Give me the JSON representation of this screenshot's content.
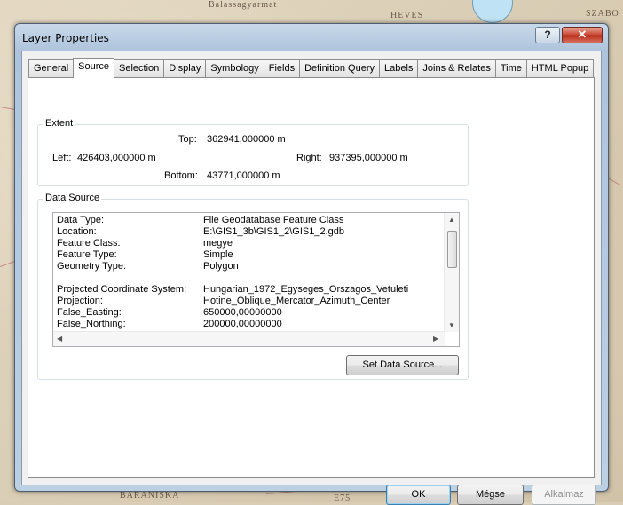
{
  "background_map": {
    "labels": [
      "Balassagyarmat",
      "HEVES",
      "SZABO",
      "BARANISKA",
      "E75"
    ]
  },
  "window": {
    "title": "Layer Properties",
    "help_label": "?",
    "close_label": "✕"
  },
  "tabs": [
    {
      "label": "General"
    },
    {
      "label": "Source",
      "active": true
    },
    {
      "label": "Selection"
    },
    {
      "label": "Display"
    },
    {
      "label": "Symbology"
    },
    {
      "label": "Fields"
    },
    {
      "label": "Definition Query"
    },
    {
      "label": "Labels"
    },
    {
      "label": "Joins & Relates"
    },
    {
      "label": "Time"
    },
    {
      "label": "HTML Popup"
    }
  ],
  "extent": {
    "label": "Extent",
    "top_label": "Top:",
    "top_value": "362941,000000 m",
    "left_label": "Left:",
    "left_value": "426403,000000 m",
    "right_label": "Right:",
    "right_value": "937395,000000 m",
    "bottom_label": "Bottom:",
    "bottom_value": "43771,000000 m"
  },
  "data_source": {
    "label": "Data Source",
    "rows": [
      {
        "key": "Data Type:",
        "value": "File Geodatabase Feature Class"
      },
      {
        "key": "Location:",
        "value": "E:\\GIS1_3b\\GIS1_2\\GIS1_2.gdb"
      },
      {
        "key": "Feature Class:",
        "value": "megye"
      },
      {
        "key": "Feature Type:",
        "value": "Simple"
      },
      {
        "key": "Geometry Type:",
        "value": "Polygon"
      },
      {
        "key": "",
        "value": ""
      },
      {
        "key": "Projected Coordinate System:",
        "value": "Hungarian_1972_Egyseges_Orszagos_Vetuleti"
      },
      {
        "key": "Projection:",
        "value": "Hotine_Oblique_Mercator_Azimuth_Center"
      },
      {
        "key": "False_Easting:",
        "value": "650000,00000000"
      },
      {
        "key": "False_Northing:",
        "value": "200000,00000000"
      }
    ],
    "set_button": "Set Data Source..."
  },
  "footer": {
    "ok": "OK",
    "cancel": "Mégse",
    "apply": "Alkalmaz"
  },
  "colors": {
    "title_bar": "#aec4dc",
    "close_button": "#c7432f",
    "default_button_border": "#3c7fb1"
  }
}
